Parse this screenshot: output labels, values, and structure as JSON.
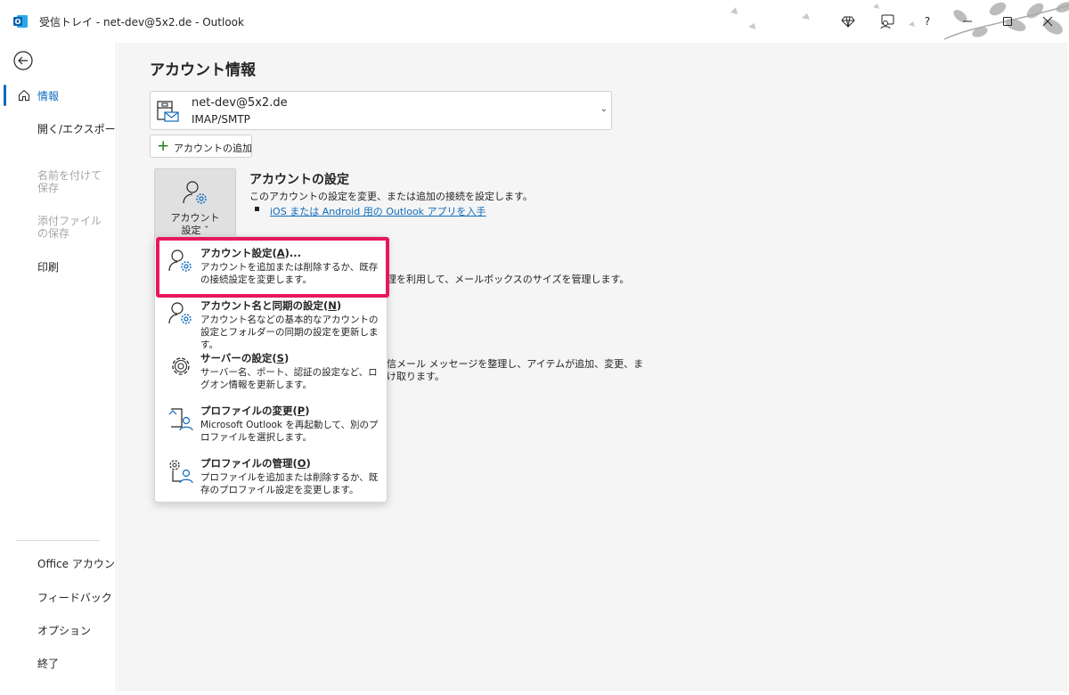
{
  "window": {
    "title": "受信トレイ - net-dev@5x2.de  -  Outlook",
    "help_label": "?"
  },
  "sidebar": {
    "items": [
      {
        "label": "情報"
      },
      {
        "label": "開く/エクスポート"
      },
      {
        "label": "名前を付けて保存"
      },
      {
        "label": "添付ファイルの保存"
      },
      {
        "label": "印刷"
      },
      {
        "label": "Office アカウント"
      },
      {
        "label": "フィードバック"
      },
      {
        "label": "オプション"
      },
      {
        "label": "終了"
      }
    ]
  },
  "main": {
    "page_title": "アカウント情報",
    "account": {
      "email": "net-dev@5x2.de",
      "type": "IMAP/SMTP"
    },
    "add_account_label": "アカウントの追加",
    "settings_button_label_line1": "アカウント",
    "settings_button_label_line2": "設定 ˇ",
    "section_title": "アカウントの設定",
    "section_desc": "このアカウントの設定を変更、または追加の接続を設定します。",
    "section_link": "iOS または Android 用の Outlook アプリを入手",
    "background_text1": "理を利用して、メールボックスのサイズを管理します。",
    "background_text2": "信メール メッセージを整理し、アイテムが追加、変更、ま",
    "background_text3": "け取ります。"
  },
  "dropdown": {
    "items": [
      {
        "title_pre": "アカウント設定(",
        "key": "A",
        "title_post": ")...",
        "desc": "アカウントを追加または削除するか、既存の接続設定を変更します。"
      },
      {
        "title_pre": "アカウント名と同期の設定(",
        "key": "N",
        "title_post": ")",
        "desc": "アカウント名などの基本的なアカウントの設定とフォルダーの同期の設定を更新します。"
      },
      {
        "title_pre": "サーバーの設定(",
        "key": "S",
        "title_post": ")",
        "desc": "サーバー名、ポート、認証の設定など、ログオン情報を更新します。"
      },
      {
        "title_pre": "プロファイルの変更(",
        "key": "P",
        "title_post": ")",
        "desc": "Microsoft Outlook を再起動して、別のプロファイルを選択します。"
      },
      {
        "title_pre": "プロファイルの管理(",
        "key": "O",
        "title_post": ")",
        "desc": "プロファイルを追加または削除するか、既存のプロファイル設定を変更します。"
      }
    ]
  },
  "colors": {
    "accent": "#0f6cbd",
    "highlight": "#e8175d"
  }
}
